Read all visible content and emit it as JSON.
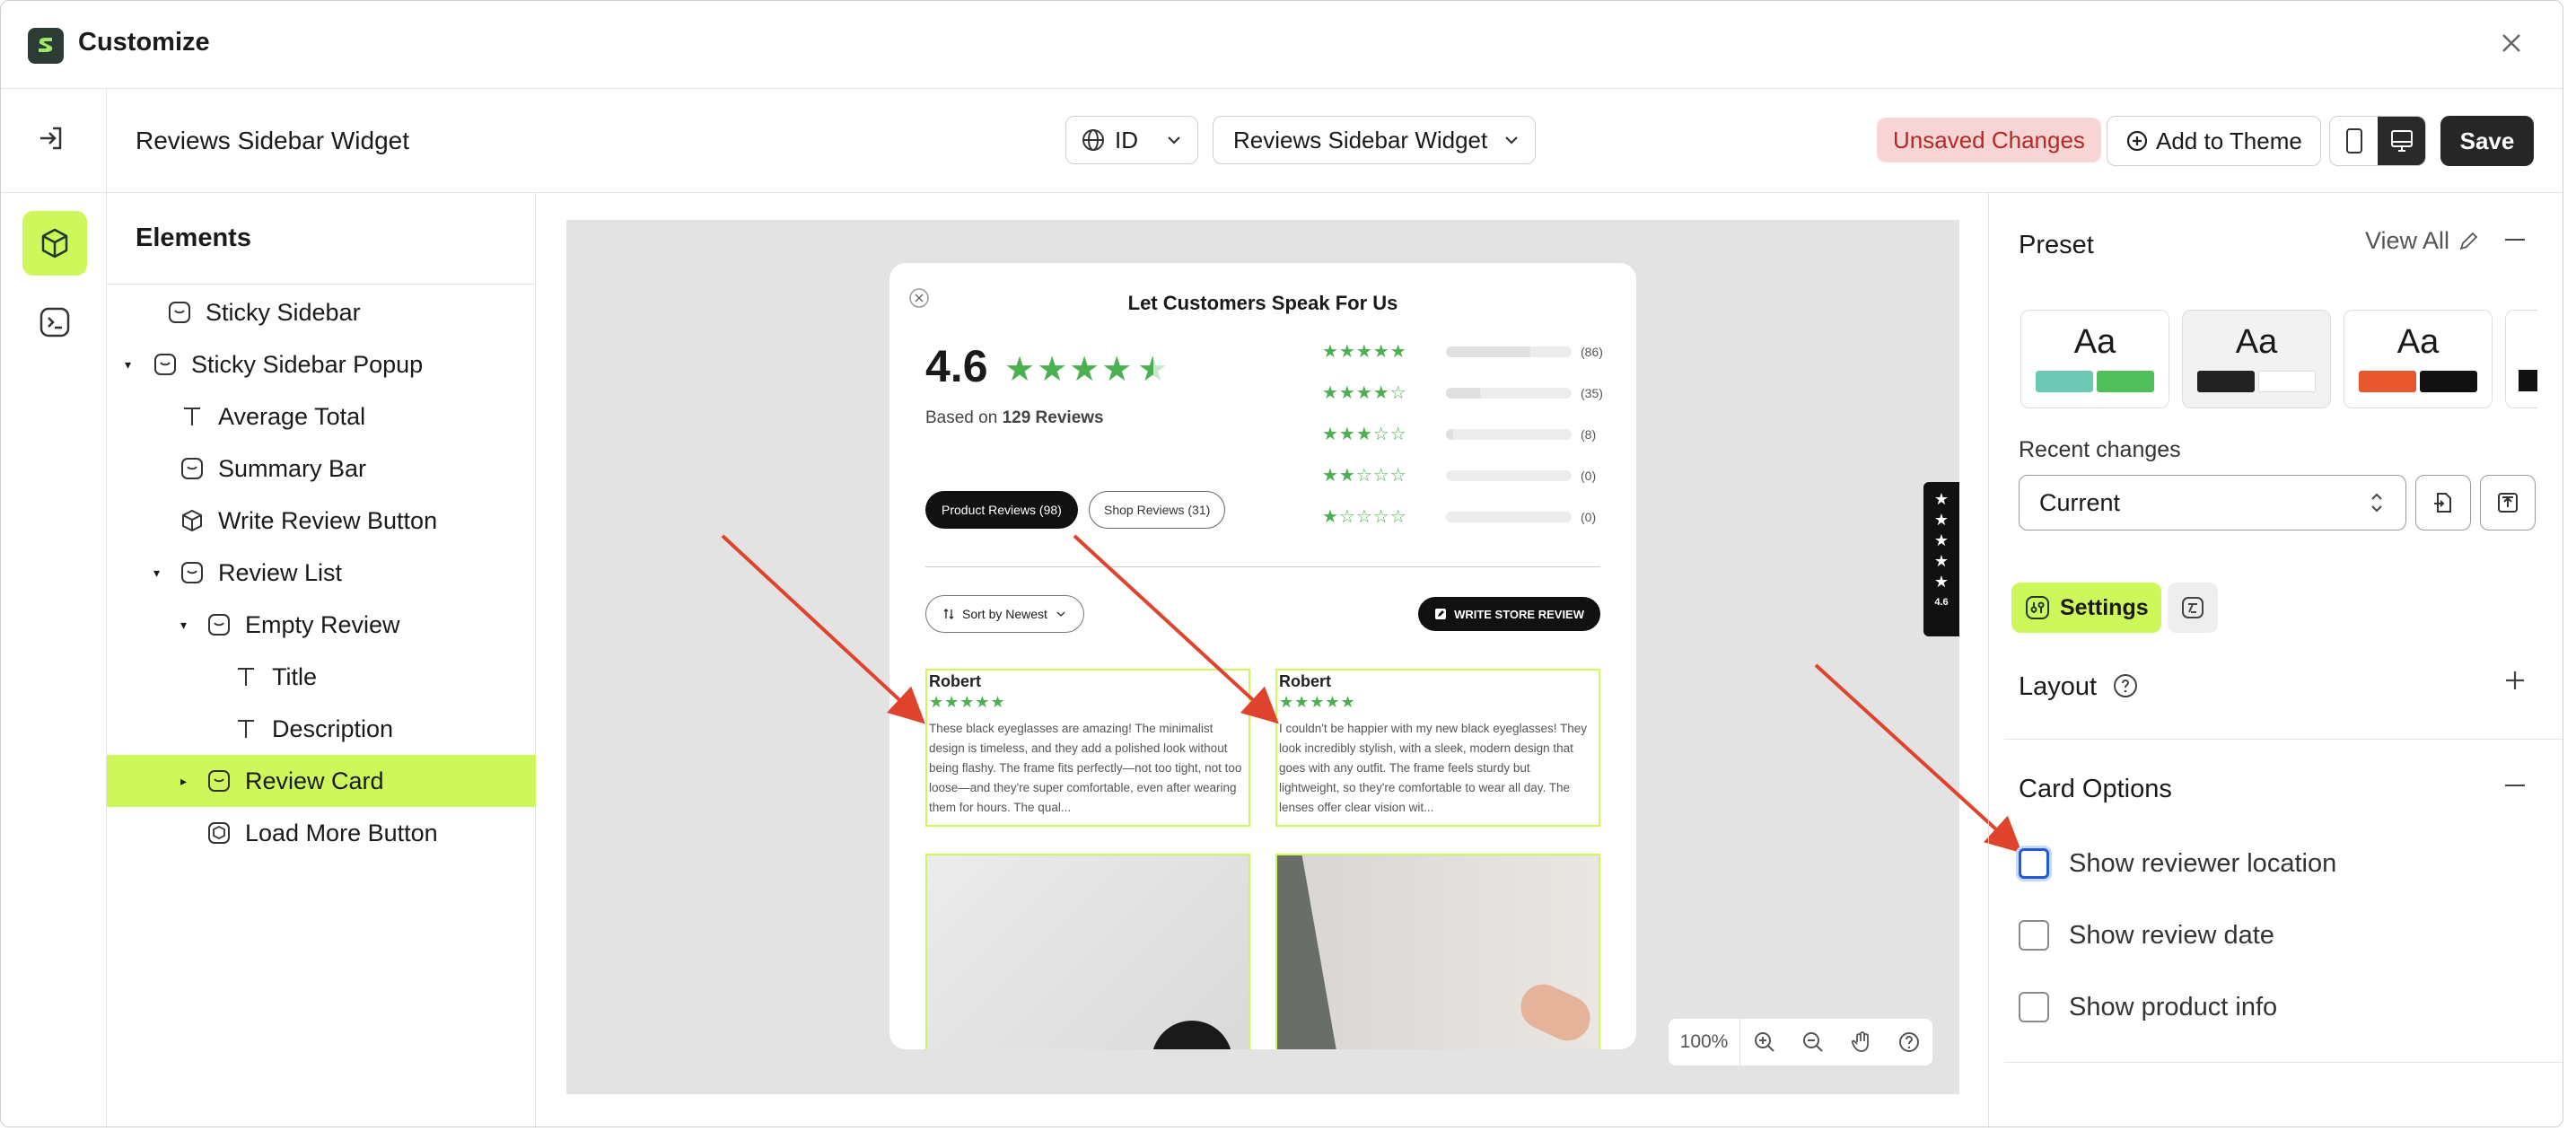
{
  "app": {
    "title": "Customize"
  },
  "topbar": {
    "page_title": "Reviews Sidebar Widget",
    "language": "ID",
    "template_select": "Reviews Sidebar Widget",
    "unsaved": "Unsaved Changes",
    "add_to_theme": "Add to Theme",
    "save": "Save"
  },
  "elements": {
    "heading": "Elements",
    "items": [
      {
        "label": "Sticky Sidebar"
      },
      {
        "label": "Sticky Sidebar Popup"
      },
      {
        "label": "Average Total"
      },
      {
        "label": "Summary Bar"
      },
      {
        "label": "Write Review Button"
      },
      {
        "label": "Review List"
      },
      {
        "label": "Empty Review"
      },
      {
        "label": "Title"
      },
      {
        "label": "Description"
      },
      {
        "label": "Review Card"
      },
      {
        "label": "Load More Button"
      }
    ]
  },
  "preview": {
    "modal_title": "Let Customers Speak For Us",
    "average": "4.6",
    "based_on_prefix": "Based on",
    "based_on_count": "129 Reviews",
    "bars": [
      {
        "stars": 5,
        "count": "(86)",
        "fill": 0.67
      },
      {
        "stars": 4,
        "count": "(35)",
        "fill": 0.27
      },
      {
        "stars": 3,
        "count": "(8)",
        "fill": 0.06
      },
      {
        "stars": 2,
        "count": "(0)",
        "fill": 0
      },
      {
        "stars": 1,
        "count": "(0)",
        "fill": 0
      }
    ],
    "tab_product": "Product Reviews (98)",
    "tab_shop": "Shop Reviews (31)",
    "sort": "Sort by Newest",
    "write_btn": "WRITE STORE REVIEW",
    "reviews": [
      {
        "name": "Robert",
        "text": "These black eyeglasses are amazing! The minimalist design is timeless, and they add a polished look without being flashy. The frame fits perfectly—not too tight, not too loose—and they're super comfortable, even after wearing them for hours. The qual..."
      },
      {
        "name": "Robert",
        "text": "I couldn't be happier with my new black eyeglasses! They look incredibly stylish, with a sleek, modern design that goes with any outfit. The frame feels sturdy but lightweight, so they're comfortable to wear all day. The lenses offer clear vision wit..."
      }
    ],
    "side_tab_rating": "4.6",
    "zoom": "100%"
  },
  "right_panel": {
    "preset": "Preset",
    "view_all": "View All",
    "preset_sample": "Aa",
    "presets": [
      {
        "c1": "#6ec9b4",
        "c2": "#4fbf5a"
      },
      {
        "c1": "#222222",
        "c2": "#ffffff"
      },
      {
        "c1": "#e8582c",
        "c2": "#111111"
      }
    ],
    "recent_changes": "Recent changes",
    "recent_value": "Current",
    "settings_tab": "Settings",
    "layout": "Layout",
    "card_options": "Card Options",
    "options": [
      {
        "label": "Show reviewer location",
        "checked": false
      },
      {
        "label": "Show review date",
        "checked": false
      },
      {
        "label": "Show product info",
        "checked": false
      }
    ]
  },
  "colors": {
    "accent": "#cdf75a",
    "star": "#4caf50",
    "arrow": "#e0432b"
  }
}
